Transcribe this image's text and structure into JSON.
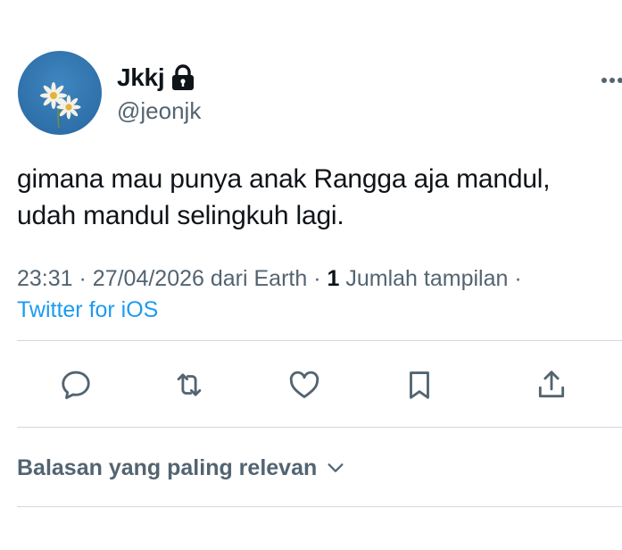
{
  "author": {
    "display_name": "Jkkj",
    "handle": "@jeonjk",
    "protected_icon": "lock-icon",
    "avatar": "daisy-flowers-on-blue-sky"
  },
  "tweet": {
    "text_line1": "gimana mau punya anak Rangga aja mandul,",
    "text_line2": "udah mandul selingkuh lagi.",
    "time": "23:31",
    "date": "27/04/2026",
    "location": "dari Earth",
    "separator": "·",
    "views_count": "1",
    "views_label": "Jumlah tampilan",
    "source": "Twitter for iOS"
  },
  "actions": [
    {
      "name": "reply",
      "icon": "reply-icon"
    },
    {
      "name": "retweet",
      "icon": "retweet-icon"
    },
    {
      "name": "like",
      "icon": "heart-icon"
    },
    {
      "name": "bookmark",
      "icon": "bookmark-icon"
    },
    {
      "name": "share",
      "icon": "share-icon"
    }
  ],
  "replies_sort": {
    "label": "Balasan yang paling relevan",
    "icon": "chevron-down-icon"
  },
  "colors": {
    "text": "#0f1419",
    "secondary": "#536471",
    "link": "#1d9bf0",
    "divider": "#cfd9de"
  }
}
